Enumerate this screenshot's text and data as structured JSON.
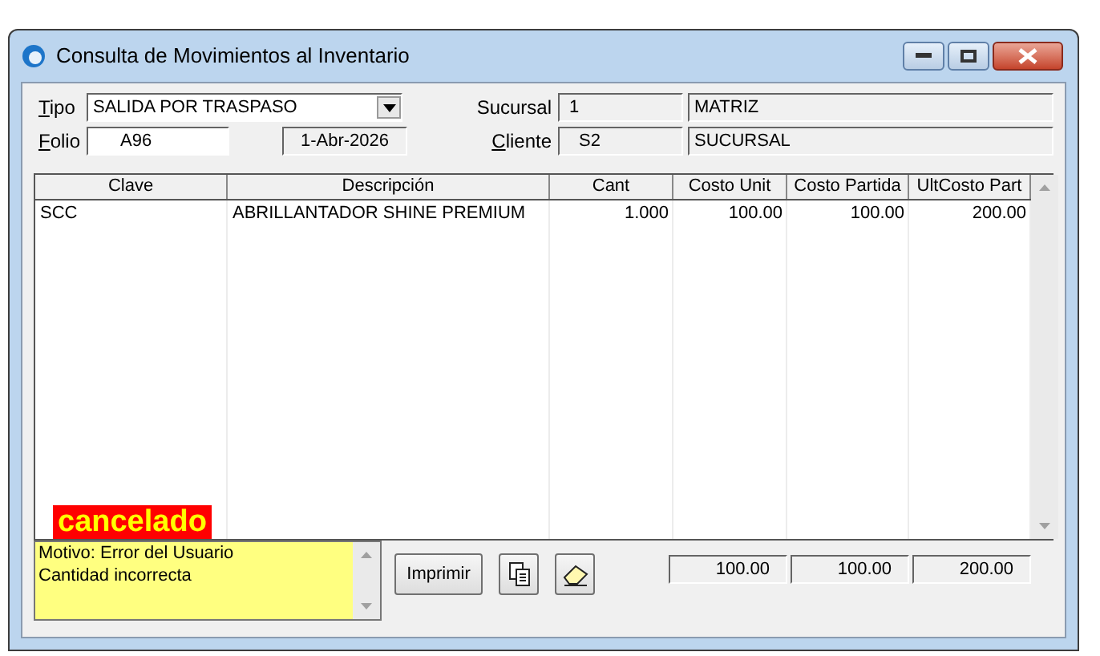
{
  "window": {
    "title": "Consulta de Movimientos al Inventario"
  },
  "header": {
    "tipo": {
      "label": "Tipo",
      "value": "SALIDA POR TRASPASO"
    },
    "folio": {
      "label": "Folio",
      "value": "A96"
    },
    "date": "1-Abr-2026",
    "sucursal": {
      "label": "Sucursal",
      "code": "1",
      "name": "MATRIZ"
    },
    "cliente": {
      "label": "Cliente",
      "code": "S2",
      "name": "SUCURSAL"
    }
  },
  "table": {
    "columns": [
      "Clave",
      "Descripción",
      "Cant",
      "Costo Unit",
      "Costo Partida",
      "UltCosto Part"
    ],
    "rows": [
      [
        "SCC",
        "ABRILLANTADOR SHINE PREMIUM",
        "1.000",
        "100.00",
        "100.00",
        "200.00"
      ]
    ]
  },
  "status": {
    "canceled_label": "cancelado",
    "reason": [
      "Motivo: Error del Usuario",
      "Cantidad incorrecta"
    ]
  },
  "buttons": {
    "print": "Imprimir"
  },
  "totals": [
    "100.00",
    "100.00",
    "200.00"
  ]
}
